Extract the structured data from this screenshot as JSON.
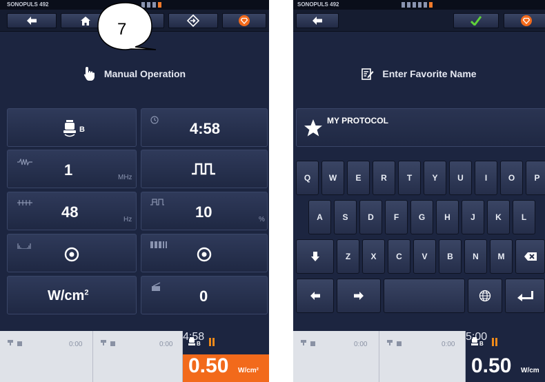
{
  "left": {
    "device_name": "SONOPULS 492",
    "title": "Manual Operation",
    "callout": "7",
    "tiles": {
      "head_label": "B",
      "timer": "4:58",
      "frequency_value": "1",
      "frequency_unit": "MHz",
      "pulse_freq_value": "48",
      "pulse_freq_unit": "Hz",
      "duty_value": "10",
      "duty_unit": "%",
      "intensity_unit_main": "W/cm",
      "intensity_unit_sup": "2",
      "intensity_value": "0"
    },
    "bottom": {
      "slot1_time": "0:00",
      "slot2_time": "0:00",
      "active_head": "B",
      "active_time": "4:58",
      "readout_value": "0.50",
      "readout_unit": "W/cm²"
    }
  },
  "right": {
    "device_name": "SONOPULS 492",
    "title": "Enter Favorite Name",
    "favorite_name": "MY PROTOCOL",
    "keys_row1": [
      "Q",
      "W",
      "E",
      "R",
      "T",
      "Y",
      "U",
      "I",
      "O",
      "P"
    ],
    "keys_row2": [
      "A",
      "S",
      "D",
      "F",
      "G",
      "H",
      "J",
      "K",
      "L"
    ],
    "keys_row3": [
      "Z",
      "X",
      "C",
      "V",
      "B",
      "N",
      "M"
    ],
    "bottom": {
      "slot1_time": "0:00",
      "slot2_time": "0:00",
      "active_head": "B",
      "active_time": "5:00",
      "readout_value": "0.50",
      "readout_unit": "W/cm"
    }
  },
  "colors": {
    "screen_bg": "#1c2540",
    "accent_orange": "#f26a1b",
    "check_green": "#5fd13a",
    "pause_orange": "#f08a1a"
  }
}
